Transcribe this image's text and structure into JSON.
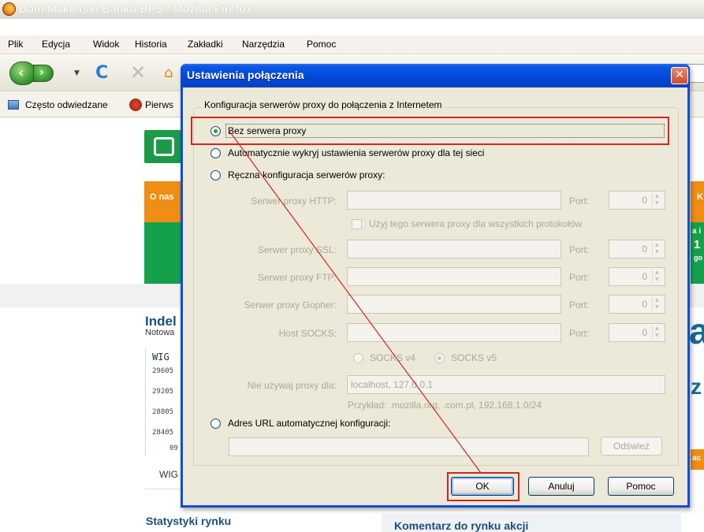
{
  "browser": {
    "window_title": "Dom Maklerski Banku BPS - Mozilla Firefox",
    "menu": [
      "Plik",
      "Edycja",
      "Widok",
      "Historia",
      "Zakładki",
      "Narzędzia",
      "Pomoc"
    ],
    "bookmarks": [
      "Często odwiedzane",
      "Pierws"
    ]
  },
  "page": {
    "banner_left": "O nas",
    "banner_right_top": "K",
    "banner_right_mid1": "a i",
    "banner_right_mid2": "1",
    "banner_right_mid3": "go",
    "indeks_title": "Indel",
    "notow": "Notowa",
    "wig": "WIG",
    "ticks": [
      "29605",
      "29205",
      "28805",
      "28405",
      "09"
    ],
    "wig_bottom": "WIG",
    "big_a": "a",
    "big_z": "z",
    "orange_small": "ac",
    "stat": "Statystyki rynku",
    "komentarz": "Komentarz do rynku akcji"
  },
  "dialog": {
    "title": "Ustawienia połączenia",
    "close_label": "✕",
    "group_legend": "Konfiguracja serwerów proxy do połączenia z Internetem",
    "options": {
      "no_proxy": "Bez serwera proxy",
      "auto_detect": "Automatycznie wykryj ustawienia serwerów proxy dla tej sieci",
      "manual": "Ręczna konfiguracja serwerów proxy:",
      "auto_url": "Adres URL automatycznej konfiguracji:"
    },
    "selected_option": "no_proxy",
    "fields": {
      "http_label": "Serwer proxy HTTP:",
      "ssl_label": "Serwer proxy SSL:",
      "ftp_label": "Serwer proxy FTP:",
      "gopher_label": "Serwer proxy Gopher:",
      "socks_label": "Host SOCKS:",
      "port_label": "Port:",
      "port_value": "0",
      "use_all": "Użyj tego serwera proxy dla wszystkich protokołów",
      "socks_v4": "SOCKS v4",
      "socks_v5": "SOCKS v5",
      "no_proxy_for_label": "Nie używaj proxy dla:",
      "no_proxy_for_value": "localhost, 127.0.0.1",
      "example": "Przykład: .mozilla.org, .com.pl, 192.168.1.0/24"
    },
    "buttons": {
      "reload": "Odśwież",
      "ok": "OK",
      "cancel": "Anuluj",
      "help": "Pomoc"
    },
    "annotation_color": "#d42424"
  }
}
